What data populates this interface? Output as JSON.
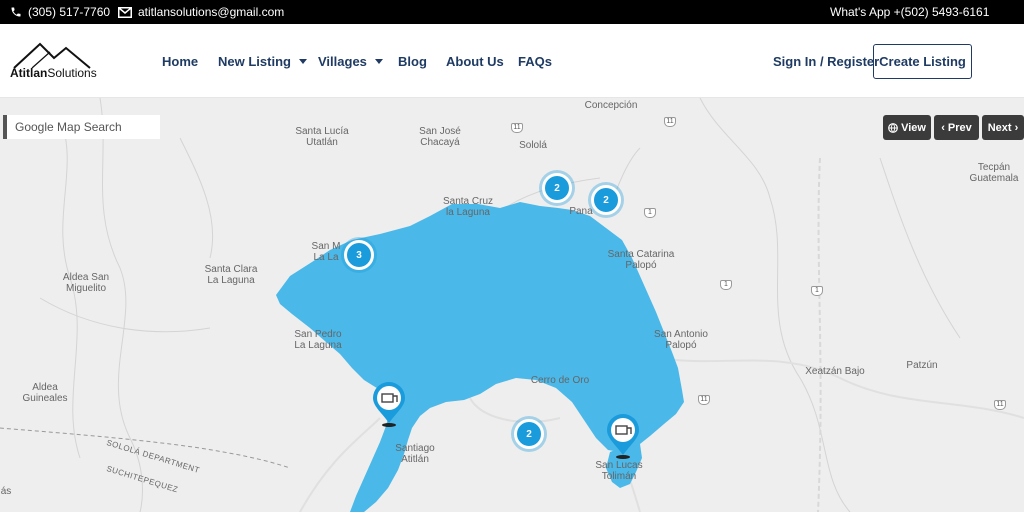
{
  "topbar": {
    "phone": "(305) 517-7760",
    "email": "atitlansolutions@gmail.com",
    "whatsapp": "What's App +(502) 5493-6161"
  },
  "header": {
    "logo_text_bold": "Atitlan",
    "logo_text_rest": "Solutions",
    "nav": {
      "home": "Home",
      "new_listing": "New Listing",
      "villages": "Villages",
      "blog": "Blog",
      "about": "About Us",
      "faqs": "FAQs"
    },
    "sign_in": "Sign In / Register",
    "create_listing": "Create Listing"
  },
  "map": {
    "search_placeholder": "Google Map Search",
    "view_label": "View",
    "prev_label": "Prev",
    "next_label": "Next",
    "places": {
      "concepcion": "Concepción",
      "santa_lucia_1": "Santa Lucía",
      "santa_lucia_2": "Utatlán",
      "san_jose_1": "San José",
      "san_jose_2": "Chacayá",
      "solola": "Sololá",
      "santa_cruz_1": "Santa Cruz",
      "santa_cruz_2": "la Laguna",
      "pana": "Pana",
      "tecpan_1": "Tecpán",
      "tecpan_2": "Guatemala",
      "san_m_1": "San M",
      "san_m_2": "La La",
      "santa_clara_1": "Santa Clara",
      "santa_clara_2": "La Laguna",
      "aldea_san_1": "Aldea San",
      "aldea_san_2": "Miguelito",
      "santa_catarina_1": "Santa Catarina",
      "santa_catarina_2": "Palopó",
      "san_pedro_1": "San Pedro",
      "san_pedro_2": "La Laguna",
      "san_antonio_1": "San Antonio",
      "san_antonio_2": "Palopó",
      "aldea_guineales_1": "Aldea",
      "aldea_guineales_2": "Guineales",
      "cerro_de_oro": "Cerro de Oro",
      "xeatzan": "Xeatzán Bajo",
      "patzun": "Patzún",
      "santiago_1": "Santiago",
      "santiago_2": "Atitlán",
      "san_lucas_1": "San Lucas",
      "san_lucas_2": "Tolimán",
      "edge_as": "ás",
      "solola_dept": "SOLOLÁ DEPARTMENT",
      "suchi_dept": "SUCHITEPEQUEZ"
    },
    "shields": {
      "s1": "11",
      "s2": "1",
      "s3": "1",
      "s4": "1",
      "s5": "11",
      "s6": "11",
      "s7": "11"
    },
    "clusters": {
      "c1": "2",
      "c2": "2",
      "c3": "3",
      "c4": "2"
    },
    "lake_color": "#4ab8e8",
    "cluster_color": "#1a9bdb"
  }
}
